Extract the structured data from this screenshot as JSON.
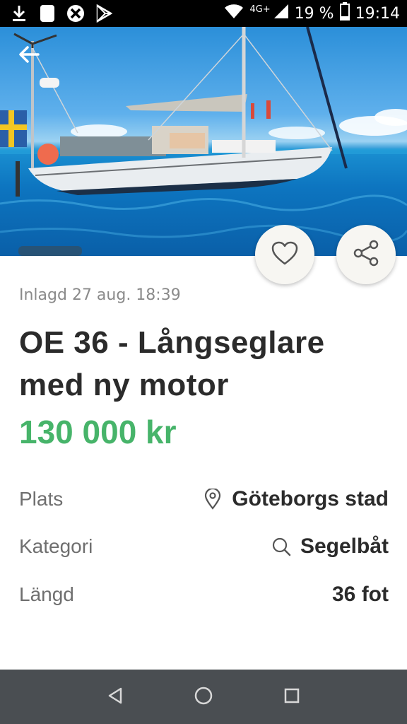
{
  "status_bar": {
    "network": "4G+",
    "battery": "19 %",
    "time": "19:14",
    "icons": [
      "download-icon",
      "moon-icon",
      "no-sound-icon",
      "play-store-icon",
      "wifi-icon",
      "signal-icon",
      "battery-icon"
    ]
  },
  "hero": {
    "image": "sailboat-photo",
    "back_icon": "arrow-left-icon"
  },
  "actions": {
    "favorite_icon": "heart-icon",
    "share_icon": "share-icon"
  },
  "listing": {
    "posted": "Inlagd 27 aug. 18:39",
    "title": "OE 36 - Långseglare med ny motor",
    "price": "130 000 kr",
    "price_color": "#47b46a"
  },
  "details": [
    {
      "label": "Plats",
      "value": "Göteborgs stad",
      "icon": "location-pin-icon"
    },
    {
      "label": "Kategori",
      "value": "Segelbåt",
      "icon": "search-icon"
    },
    {
      "label": "Längd",
      "value": "36 fot",
      "icon": ""
    }
  ],
  "nav_bar": {
    "buttons": [
      "back-triangle-icon",
      "home-circle-icon",
      "recents-square-icon"
    ]
  }
}
